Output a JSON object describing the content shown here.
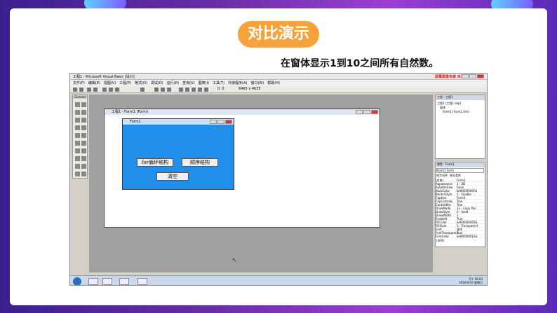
{
  "slide": {
    "title": "对比演示",
    "subtitle": "在窗体显示1到10之间所有自然数。"
  },
  "window": {
    "title": "工程1 - Microsoft Visual Basic [设计]",
    "watermark": "屏幕录像专家 未注册",
    "menu": [
      "文件(F)",
      "编辑(E)",
      "视图(V)",
      "工程(P)",
      "格式(O)",
      "调试(D)",
      "运行(R)",
      "查询(U)",
      "图表(I)",
      "工具(T)",
      "外接程序(A)",
      "窗口(W)",
      "帮助(H)"
    ],
    "toolbar_coords_1": "0, 0",
    "toolbar_coords_2": "6465 x 4635"
  },
  "toolbox": {
    "label": "General"
  },
  "ide_form": {
    "title": "工程1 - Form1 (Form)"
  },
  "run_form": {
    "title": "Form1",
    "buttons": [
      "for循环结构",
      "顺序结构",
      "清空"
    ]
  },
  "project_panel": {
    "title": "工程 - 工程1",
    "tree": [
      "工程1 (工程1.vbp)",
      "窗体",
      "Form1 (Form1.frm)"
    ]
  },
  "properties_panel": {
    "title": "属性 - Form1",
    "object": "Form1 Form",
    "tabs": [
      "按字母序",
      "按分类序"
    ],
    "rows": [
      [
        "(名称)",
        "Form1"
      ],
      [
        "Appearance",
        "1 - 3D"
      ],
      [
        "AutoRedraw",
        "False"
      ],
      [
        "BackColor",
        "&H8000000F&"
      ],
      [
        "BorderStyle",
        "2 - Sizable"
      ],
      [
        "Caption",
        "Form1"
      ],
      [
        "ClipControls",
        "True"
      ],
      [
        "ControlBox",
        "True"
      ],
      [
        "DrawMode",
        "13 - Copy Pen"
      ],
      [
        "DrawStyle",
        "0 - Solid"
      ],
      [
        "DrawWidth",
        "1"
      ],
      [
        "Enabled",
        "True"
      ],
      [
        "FillColor",
        "&H00000000&"
      ],
      [
        "FillStyle",
        "1 - Transparent"
      ],
      [
        "Font",
        "宋体"
      ],
      [
        "FontTransparent",
        "True"
      ],
      [
        "ForeColor",
        "&H80000012&"
      ]
    ],
    "footer": "(名称)"
  },
  "taskbar": {
    "time": "下午 16:03",
    "date": "2016/4/10 星期日"
  },
  "colors": {
    "badge": "#f6a13a",
    "run_form_bg": "#1f8fea"
  }
}
